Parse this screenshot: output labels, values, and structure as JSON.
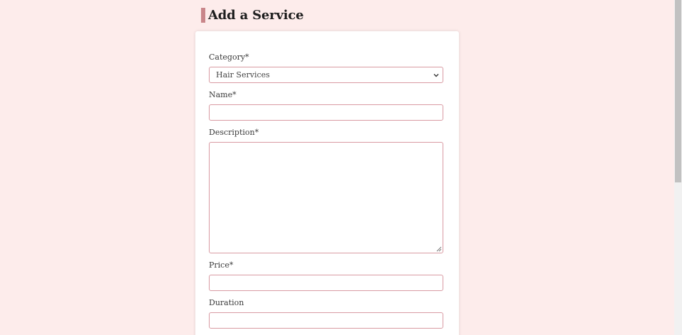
{
  "page": {
    "title": "Add a Service"
  },
  "form": {
    "category": {
      "label": "Category*",
      "value": "Hair Services"
    },
    "name": {
      "label": "Name*",
      "value": ""
    },
    "description": {
      "label": "Description*",
      "value": ""
    },
    "price": {
      "label": "Price*",
      "value": ""
    },
    "duration": {
      "label": "Duration",
      "value": ""
    }
  },
  "colors": {
    "background": "#fdeceb",
    "accent": "#c9868a",
    "field_border": "#d99aa2"
  }
}
